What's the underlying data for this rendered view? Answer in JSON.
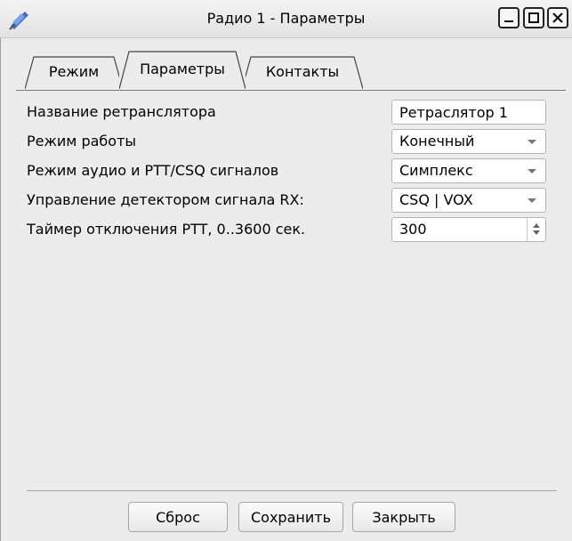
{
  "window": {
    "title": "Радио 1 - Параметры",
    "icon": "satellite-icon",
    "controls": [
      "minimize-icon",
      "maximize-icon",
      "close-icon"
    ]
  },
  "tabs": [
    {
      "label": "Режим",
      "active": false
    },
    {
      "label": "Параметры",
      "active": true
    },
    {
      "label": "Контакты",
      "active": false
    }
  ],
  "form": {
    "relay_name": {
      "label": "Название ретранслятора",
      "value": "Ретраслятор 1"
    },
    "work_mode": {
      "label": "Режим работы",
      "value": "Конечный"
    },
    "audio_mode": {
      "label": "Режим аудио и PTT/CSQ сигналов",
      "value": "Симплекс"
    },
    "rx_detector": {
      "label": "Управление детектором сигнала RX:",
      "value": "CSQ | VOX"
    },
    "ptt_timer": {
      "label": "Таймер отключения PTT, 0..3600 сек.",
      "value": "300"
    }
  },
  "buttons": {
    "reset": "Сброс",
    "save": "Сохранить",
    "close": "Закрыть"
  }
}
